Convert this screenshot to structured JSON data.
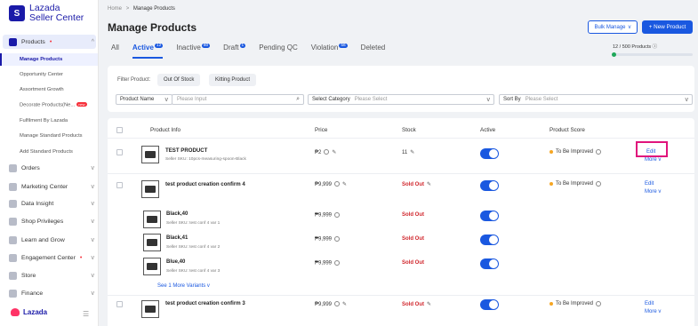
{
  "brand": {
    "line1": "Lazada",
    "line2": "Seller Center",
    "footer": "Lazada",
    "logo_letter": "S"
  },
  "sidebar": {
    "products_label": "Products",
    "sub_items": [
      "Manage Products",
      "Opportunity Center",
      "Assortment Growth",
      "Decorate Products(Ne...",
      "Fulfilment By Lazada",
      "Manage Standard Products",
      "Add Standard Products"
    ],
    "new_badge": "new",
    "sections": [
      "Orders",
      "Marketing Center",
      "Data Insight",
      "Shop Privileges",
      "Learn and Grow",
      "Engagement Center",
      "Store",
      "Finance"
    ]
  },
  "breadcrumb": {
    "home": "Home",
    "sep": ">",
    "current": "Manage Products"
  },
  "header": {
    "title": "Manage Products",
    "bulk_label": "Bulk Manage",
    "new_label": "+ New Product"
  },
  "tabs": [
    {
      "label": "All",
      "count": ""
    },
    {
      "label": "Active",
      "count": "12"
    },
    {
      "label": "Inactive",
      "count": "80"
    },
    {
      "label": "Draft",
      "count": "1"
    },
    {
      "label": "Pending QC",
      "count": ""
    },
    {
      "label": "Violation",
      "count": "56"
    },
    {
      "label": "Deleted",
      "count": ""
    }
  ],
  "quota": {
    "text": "12 / 500 Products",
    "used": 12,
    "total": 500
  },
  "filter": {
    "label": "Filter Product:",
    "chips": [
      "Out Of Stock",
      "Kitting Product"
    ],
    "name_select": "Product Name",
    "input_placeholder": "Please Input",
    "category_label": "Select Category",
    "category_placeholder": "Please Select",
    "sort_label": "Sort By",
    "sort_placeholder": "Please Select"
  },
  "table": {
    "headers": {
      "info": "Product Info",
      "price": "Price",
      "stock": "Stock",
      "active": "Active",
      "score": "Product Score"
    },
    "edit_label": "Edit",
    "more_label": "More",
    "rows": [
      {
        "name": "TEST PRODUCT",
        "sku": "Seller SKU: 10pcs-measuring-spoon-Black",
        "price": "₱2",
        "stock": "11",
        "score": "To Be Improved"
      },
      {
        "name": "test product creation confirm 4",
        "sku": "",
        "price": "₱9,999",
        "stock": "Sold Out",
        "score": "To Be Improved",
        "variants": [
          {
            "name": "Black,40",
            "sku": "Seller SKU: test conf 4 var 1",
            "price": "₱9,999",
            "stock": "Sold Out"
          },
          {
            "name": "Black,41",
            "sku": "Seller SKU: test conf 4 var 2",
            "price": "₱9,999",
            "stock": "Sold Out"
          },
          {
            "name": "Blue,40",
            "sku": "Seller SKU: test conf 4 var 3",
            "price": "₱9,999",
            "stock": "Sold Out"
          }
        ],
        "see_more": "See 1 More Variants"
      },
      {
        "name": "test product creation confirm 3",
        "sku": "",
        "price": "₱9,999",
        "stock": "Sold Out",
        "score": "To Be Improved"
      }
    ]
  },
  "colors": {
    "brand": "#1a1aa8",
    "primary": "#1a58e0",
    "sold_out": "#d0252b",
    "highlight": "#e0147c"
  }
}
